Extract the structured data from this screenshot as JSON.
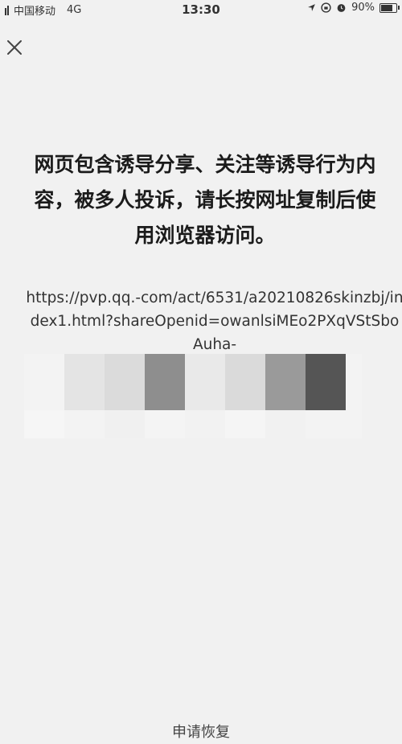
{
  "status": {
    "carrier": "中国移动",
    "network": "4G",
    "time": "13:30",
    "battery": "90%",
    "battery_level": 0.9
  },
  "icons": {
    "close": "close-icon",
    "location": "location-icon",
    "lock_rotation": "rotation-lock-icon",
    "alarm": "alarm-icon",
    "battery": "battery-icon",
    "signal": "signal-icon"
  },
  "warning": {
    "message": "网页包含诱导分享、关注等诱导行为内容，被多人投诉，请长按网址复制后使用浏览器访问。"
  },
  "url": {
    "text": "https://pvp.qq.-com/act/6531/a20210826skinzbj/index1.html?shareOpenid=owanlsiMEo2PXqVStSboAuha-"
  },
  "footer": {
    "appeal_label": "申请恢复"
  },
  "colors": {
    "background": "#f1f1f1",
    "text": "#1b1b1b",
    "mosaic": [
      "#f3f3f3",
      "#e4e4e4",
      "#dbdbdb",
      "#8e8e8e",
      "#e9e9e9",
      "#dadada",
      "#9a9a9a",
      "#555555"
    ]
  }
}
